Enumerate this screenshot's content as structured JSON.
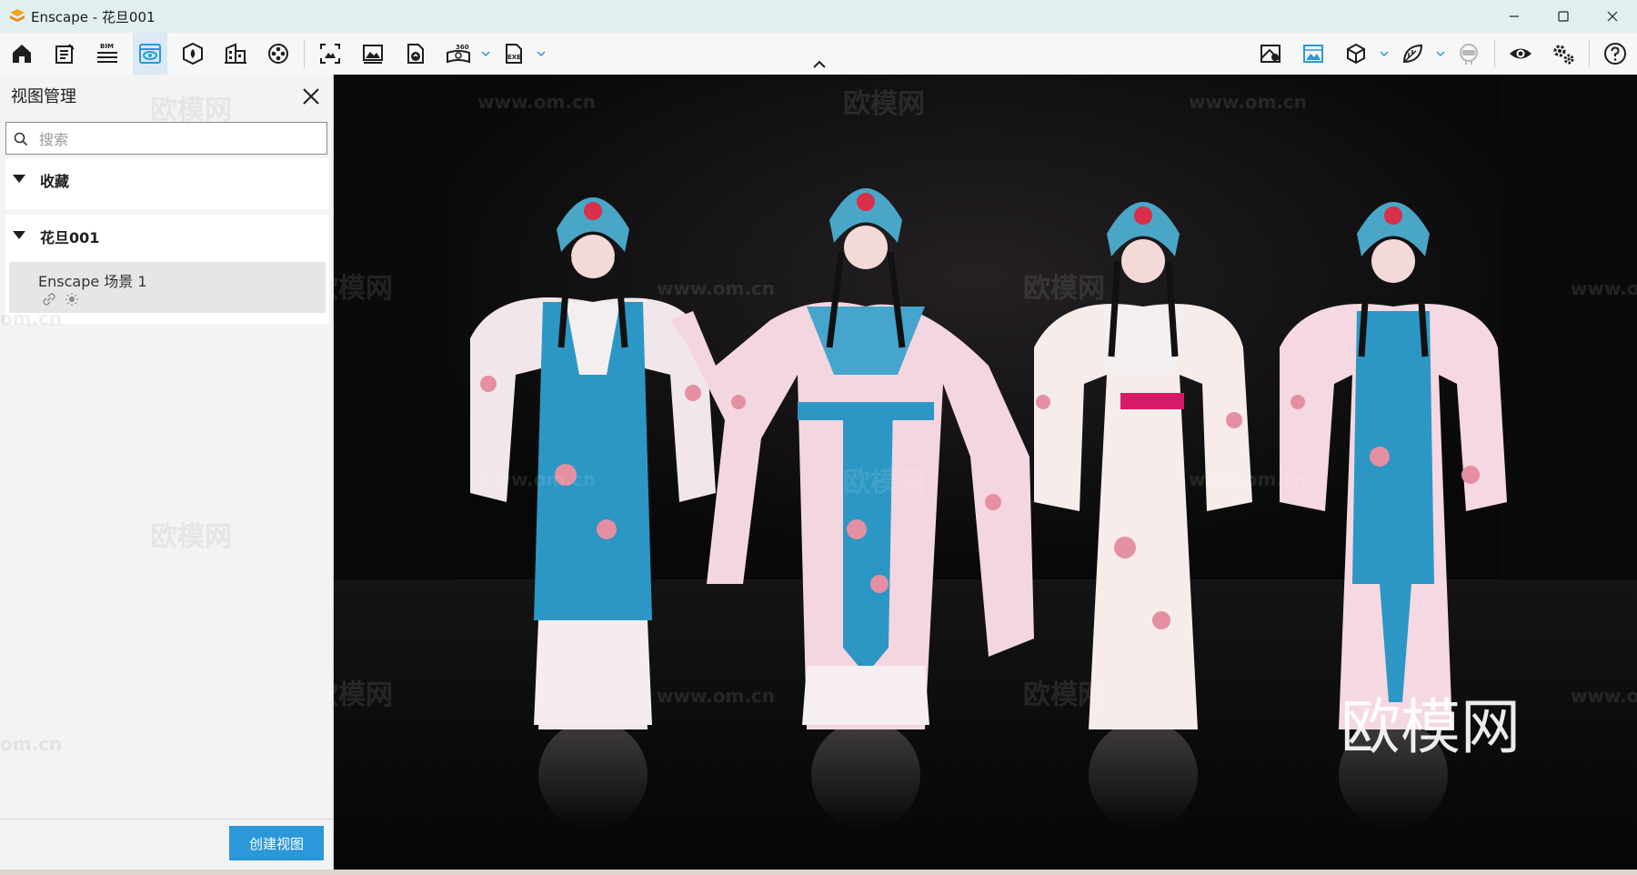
{
  "window": {
    "title": "Enscape - 花旦001",
    "controls": [
      "minimize-icon",
      "maximize-icon",
      "close-icon"
    ]
  },
  "toolbar": {
    "left_icons": [
      "home-icon",
      "project-notes-icon",
      "bim-icon",
      "views-eye-icon",
      "asset-library-icon",
      "building-icon",
      "video-reel-icon",
      "screenshot-icon",
      "image-icon",
      "upload-icon",
      "360-panorama-icon",
      "exe-export-icon"
    ],
    "right_icons": [
      "map-icon",
      "sky-image-icon",
      "cube-icon",
      "material-leaf-icon",
      "vr-headset-icon",
      "visual-settings-eye-icon",
      "settings-gear-icon",
      "help-icon"
    ],
    "bim_label": "BIM",
    "pano_label": "360",
    "exe_label": "EXE",
    "active_tool": "views-eye-icon"
  },
  "sidebar": {
    "title": "视图管理",
    "search_placeholder": "搜索",
    "sections": [
      {
        "label": "收藏",
        "expanded": true,
        "items": []
      },
      {
        "label": "花旦001",
        "expanded": true,
        "items": [
          {
            "name": "Enscape 场景 1"
          }
        ]
      }
    ],
    "create_button": "创建视图"
  },
  "viewport": {
    "watermark_url": "www.om.cn",
    "watermark_brand": "欧模网",
    "watermark_partial": "www.o",
    "watermark_partial_left": "om.cn"
  },
  "colors": {
    "accent": "#2a98d9",
    "titlebar": "#e1f0ee",
    "active_tab": "#dbe9f5"
  }
}
